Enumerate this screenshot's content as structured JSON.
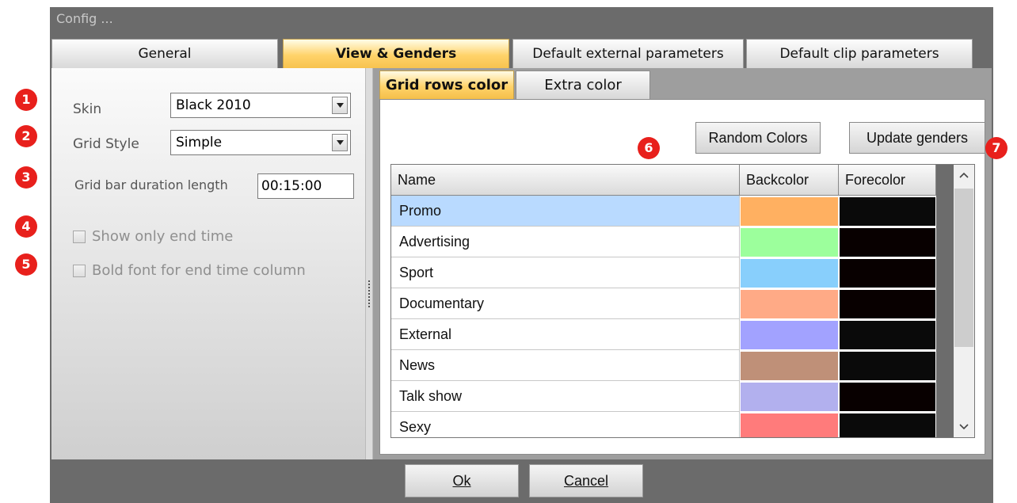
{
  "window": {
    "title": "Config ..."
  },
  "main_tabs": [
    {
      "label": "General",
      "active": false
    },
    {
      "label": "View & Genders",
      "active": true
    },
    {
      "label": "Default external parameters",
      "active": false
    },
    {
      "label": "Default clip parameters",
      "active": false
    }
  ],
  "left": {
    "skin_label": "Skin",
    "skin_value": "Black 2010",
    "grid_style_label": "Grid Style",
    "grid_style_value": "Simple",
    "bar_duration_label": "Grid bar duration length",
    "bar_duration_value": "00:15:00",
    "show_end_time_label": "Show only end time",
    "show_end_time_checked": false,
    "bold_font_label": "Bold font for end time column",
    "bold_font_checked": false
  },
  "badges": [
    "1",
    "2",
    "3",
    "4",
    "5",
    "6",
    "7"
  ],
  "inner_tabs": [
    {
      "label": "Grid rows color",
      "active": true
    },
    {
      "label": "Extra color",
      "active": false
    }
  ],
  "buttons": {
    "random_colors": "Random Colors",
    "update_genders": "Update genders"
  },
  "grid": {
    "columns": [
      "Name",
      "Backcolor",
      "Forecolor"
    ],
    "rows": [
      {
        "name": "Promo",
        "back": "#ffb061",
        "fore": "#0a0a0a",
        "selected": true
      },
      {
        "name": "Advertising",
        "back": "#9cff9c",
        "fore": "#080000",
        "selected": false
      },
      {
        "name": "Sport",
        "back": "#88cffc",
        "fore": "#080000",
        "selected": false
      },
      {
        "name": "Documentary",
        "back": "#ffaa86",
        "fore": "#080000",
        "selected": false
      },
      {
        "name": "External",
        "back": "#a2a2ff",
        "fore": "#0a0a0a",
        "selected": false
      },
      {
        "name": "News",
        "back": "#bf9078",
        "fore": "#0a0a0a",
        "selected": false
      },
      {
        "name": "Talk show",
        "back": "#b2b0ee",
        "fore": "#080000",
        "selected": false
      },
      {
        "name": "Sexy",
        "back": "#ff7b7b",
        "fore": "#0a0a0a",
        "selected": false
      }
    ]
  },
  "footer": {
    "ok_label": "Ok",
    "cancel_label": "Cancel"
  }
}
